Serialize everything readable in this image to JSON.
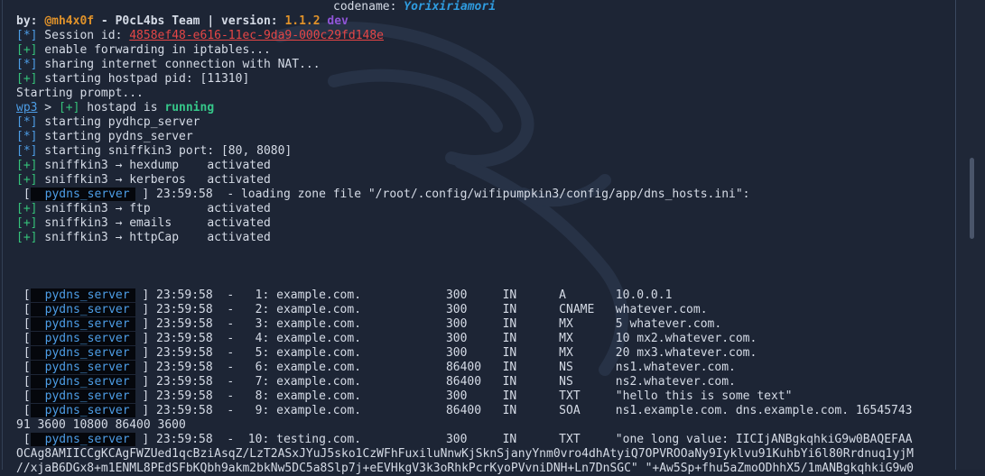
{
  "header": {
    "codename_label": "codename: ",
    "codename": "Yorixiriamori",
    "by_label": "by: ",
    "author": "@mh4x0f",
    "team": " - P0cL4bs Team | version: ",
    "version": "1.1.2",
    "channel": "dev"
  },
  "session": {
    "label": " Session id: ",
    "id": "4858ef48-e616-11ec-9da9-000c29fd148e"
  },
  "startup_lines": [
    " enable forwarding in iptables...",
    " sharing internet connection with NAT...",
    " starting hostpad pid: [11310]"
  ],
  "starting_prompt": "Starting prompt...",
  "prompt": {
    "name": "wp3",
    "sep": " > ",
    "tag": "[+]",
    "text": " hostapd is ",
    "status": "running"
  },
  "services_lines": [
    " starting pydhcp_server",
    " starting pydns_server",
    " starting sniffkin3 port: [80, 8080]",
    " sniffkin3 → hexdump    activated",
    " sniffkin3 → kerberos   activated"
  ],
  "zone_line": {
    "server": "pydns_server",
    "text": "] 23:59:58  - loading zone file \"/root/.config/wifipumpkin3/config/app/dns_hosts.ini\":"
  },
  "plugins_lines": [
    " sniffkin3 → ftp        activated",
    " sniffkin3 → emails     activated",
    " sniffkin3 → httpCap    activated"
  ],
  "dns_server": "pydns_server",
  "dns_rows": [
    "] 23:59:58  -   1: example.com.            300     IN      A       10.0.0.1",
    "] 23:59:58  -   2: example.com.            300     IN      CNAME   whatever.com.",
    "] 23:59:58  -   3: example.com.            300     IN      MX      5 whatever.com.",
    "] 23:59:58  -   4: example.com.            300     IN      MX      10 mx2.whatever.com.",
    "] 23:59:58  -   5: example.com.            300     IN      MX      20 mx3.whatever.com.",
    "] 23:59:58  -   6: example.com.            86400   IN      NS      ns1.whatever.com.",
    "] 23:59:58  -   7: example.com.            86400   IN      NS      ns2.whatever.com.",
    "] 23:59:58  -   8: example.com.            300     IN      TXT     \"hello this is some text\"",
    "] 23:59:58  -   9: example.com.            86400   IN      SOA     ns1.example.com. dns.example.com. 16545743"
  ],
  "soa_cont": "91 3600 10800 86400 3600",
  "row10": "] 23:59:58  -  10: testing.com.            300     IN      TXT     \"one long value: IICIjANBgkqhkiG9w0BAQEFAA",
  "row10_cont1": "OCAg8AMIICCgKCAgFWZUed1qcBziAsqZ/LzT2ASxJYuJ5sko1CzWFhFuxiluNnwKjSknSjanyYnm0vro4dhAtyiQ7OPVROOaNy9Iyklvu91KuhbYi6l80Rrdnuq1yjM",
  "row10_cont2": "//xjaB6DGx8+m1ENML8PEdSFbKQbh9akm2bkNw5DC5a8Slp7j+eEVHkgV3k3oRhkPcrKyoPVvniDNH+Ln7DnSGC\" \"+Aw5Sp+fhu5aZmoODhhX5/1mANBgkqhkiG9w0"
}
